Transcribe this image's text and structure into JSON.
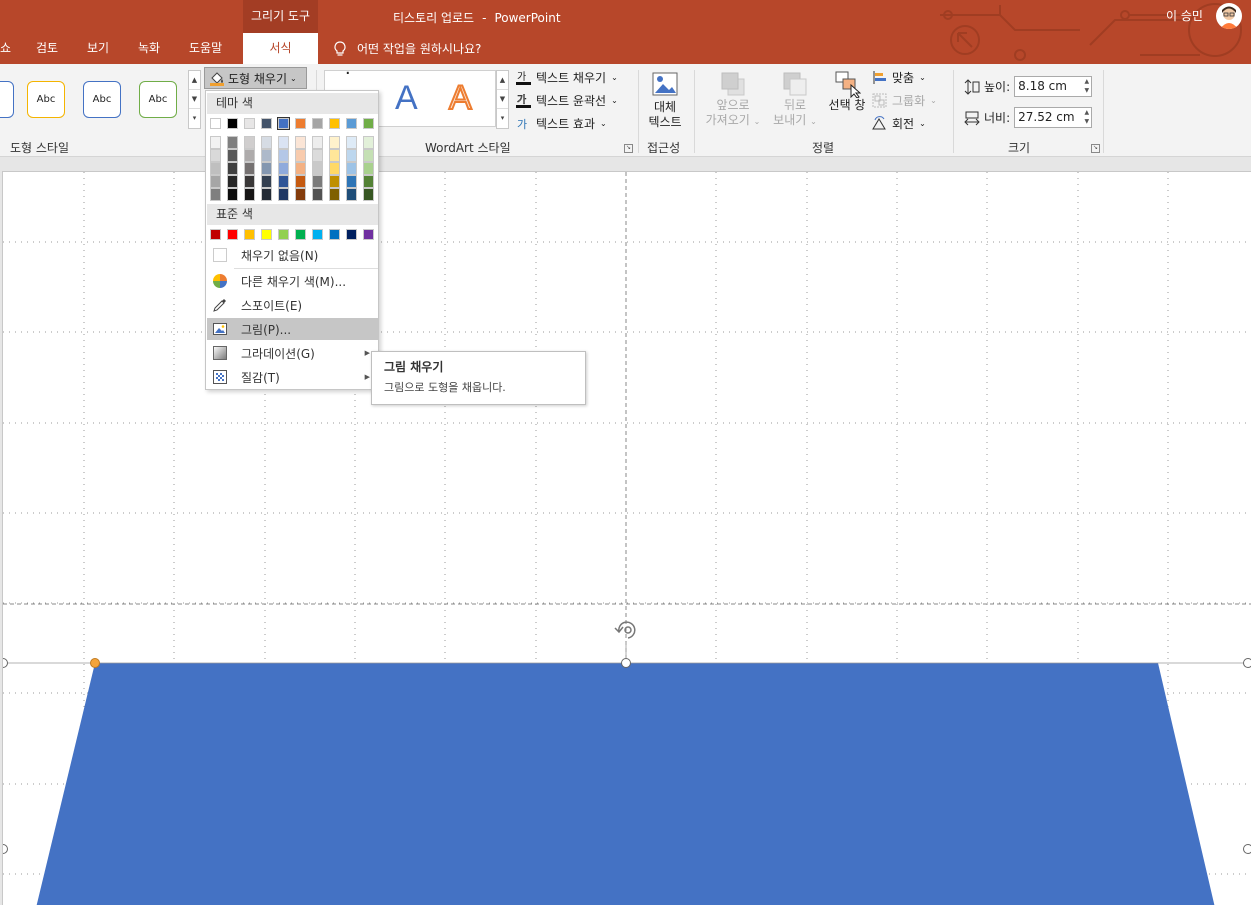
{
  "window": {
    "context_tab_group": "그리기 도구",
    "doc_name": "티스토리 업로드",
    "title_separator": "-",
    "app_name": "PowerPoint",
    "user_name": "이 승민"
  },
  "tabs": [
    {
      "label": "쇼"
    },
    {
      "label": "검토"
    },
    {
      "label": "보기"
    },
    {
      "label": "녹화"
    },
    {
      "label": "도움말"
    },
    {
      "label": "서식",
      "active": true
    }
  ],
  "tell_me": "어떤 작업을 원하시나요?",
  "ribbon": {
    "shape_styles": {
      "label": "도형 스타일",
      "preview_text": "Abc",
      "fill_button": "도형 채우기",
      "style_colors": [
        "#4472c4",
        "#f4b400",
        "#4472c4",
        "#70ad47"
      ]
    },
    "wordart": {
      "label": "WordArt 스타일",
      "letter": "A",
      "text_fill": "텍스트 채우기",
      "text_outline": "텍스트 윤곽선",
      "text_effects": "텍스트 효과"
    },
    "accessibility": {
      "label": "접근성",
      "alt_text_line1": "대체",
      "alt_text_line2": "텍스트"
    },
    "arrange": {
      "label": "정렬",
      "bring_forward_1": "앞으로",
      "bring_forward_2": "가져오기",
      "send_backward_1": "뒤로",
      "send_backward_2": "보내기",
      "selection_pane": "선택 창",
      "align": "맞춤",
      "group": "그룹화",
      "rotate": "회전"
    },
    "size": {
      "label": "크기",
      "height_label": "높이:",
      "height_value": "8.18 cm",
      "width_label": "너비:",
      "width_value": "27.52 cm"
    }
  },
  "fill_menu": {
    "theme_header": "테마 색",
    "standard_header": "표준 색",
    "theme_colors": [
      "#ffffff",
      "#000000",
      "#e7e6e6",
      "#44546a",
      "#4472c4",
      "#ed7d31",
      "#a5a5a5",
      "#ffc000",
      "#5b9bd5",
      "#70ad47"
    ],
    "theme_shades": [
      [
        "#f2f2f2",
        "#7f7f7f",
        "#d0cece",
        "#d6dce4",
        "#dae3f3",
        "#fbe5d6",
        "#ededed",
        "#fff2cc",
        "#deebf7",
        "#e2f0d9"
      ],
      [
        "#d9d9d9",
        "#595959",
        "#aeabab",
        "#adb9ca",
        "#b4c7e7",
        "#f8cbad",
        "#dbdbdb",
        "#ffe699",
        "#bdd7ee",
        "#c5e0b4"
      ],
      [
        "#bfbfbf",
        "#404040",
        "#757171",
        "#8497b0",
        "#8faadc",
        "#f4b183",
        "#c9c9c9",
        "#ffd966",
        "#9dc3e6",
        "#a9d18e"
      ],
      [
        "#a6a6a6",
        "#262626",
        "#3a3838",
        "#333f50",
        "#2f5597",
        "#c55a11",
        "#7b7b7b",
        "#bf9000",
        "#2e75b6",
        "#548235"
      ],
      [
        "#7f7f7f",
        "#0d0d0d",
        "#171616",
        "#222a35",
        "#203864",
        "#843c0c",
        "#525252",
        "#7f6000",
        "#1f4e79",
        "#385723"
      ]
    ],
    "standard_colors": [
      "#c00000",
      "#ff0000",
      "#ffc000",
      "#ffff00",
      "#92d050",
      "#00b050",
      "#00b0f0",
      "#0070c0",
      "#002060",
      "#7030a0"
    ],
    "selected_color": "#4472c4",
    "no_fill": "채우기 없음(N)",
    "more_colors": "다른 채우기 색(M)...",
    "eyedropper": "스포이트(E)",
    "picture": "그림(P)...",
    "gradient": "그라데이션(G)",
    "texture": "질감(T)"
  },
  "tooltip": {
    "title": "그림 채우기",
    "body": "그림으로 도형을 채웁니다."
  },
  "shape": {
    "fill_color": "#4472c4"
  }
}
